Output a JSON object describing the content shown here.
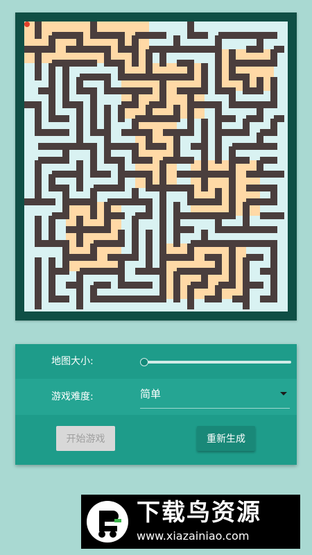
{
  "colors": {
    "background": "#a9d9d2",
    "maze_frame": "#0f4f45",
    "maze_wall": "#4a3e3d",
    "path_blue": "#d9f2f2",
    "path_peach": "#ffd9a6",
    "player": "#e0412b",
    "card": "#1e9c8a"
  },
  "maze": {
    "player_icon": "red-dot-icon"
  },
  "controls": {
    "map_size_label": "地图大小:",
    "map_size_value": 0,
    "difficulty_label": "游戏难度:",
    "difficulty_value": "简单",
    "start_button": "开始游戏",
    "start_enabled": false,
    "regenerate_button": "重新生成"
  },
  "watermark": {
    "title": "下载鸟资源",
    "url": "www.xiazainiao.com",
    "logo_icon": "bird-logo-icon"
  }
}
